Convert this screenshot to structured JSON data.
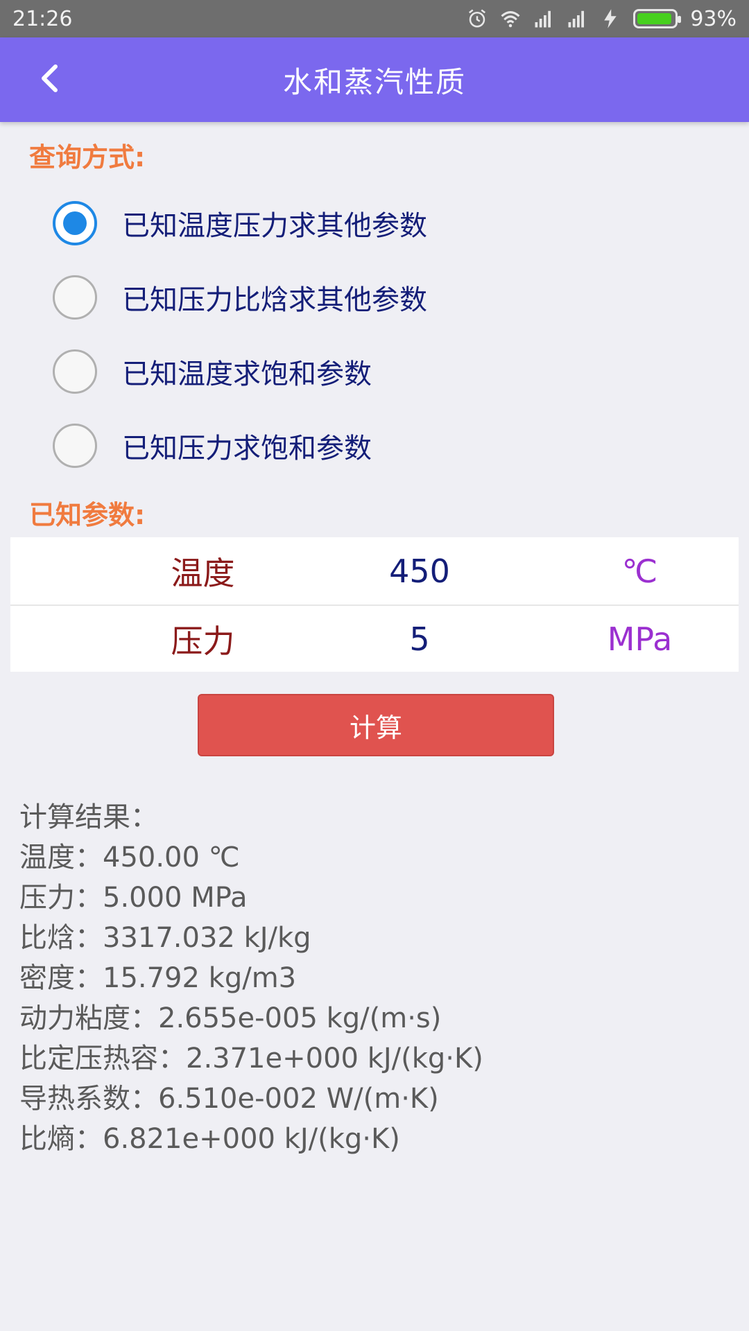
{
  "status": {
    "time": "21:26",
    "battery": "93%",
    "battery_level": 0.93
  },
  "appbar": {
    "title": "水和蒸汽性质",
    "back_icon": "chevron-left-icon"
  },
  "query": {
    "label": "查询方式:",
    "options": [
      {
        "label": "已知温度压力求其他参数",
        "checked": true
      },
      {
        "label": "已知压力比焓求其他参数",
        "checked": false
      },
      {
        "label": "已知温度求饱和参数",
        "checked": false
      },
      {
        "label": "已知压力求饱和参数",
        "checked": false
      }
    ]
  },
  "params": {
    "label": "已知参数:",
    "rows": [
      {
        "name": "温度",
        "value": "450",
        "unit": "℃"
      },
      {
        "name": "压力",
        "value": "5",
        "unit": "MPa"
      }
    ]
  },
  "calc_button": "计算",
  "results": {
    "lines": [
      "计算结果：",
      "温度：450.00 ℃",
      "压力：5.000 MPa",
      "比焓：3317.032 kJ/kg",
      "密度：15.792 kg/m3",
      "动力粘度：2.655e-005 kg/(m·s)",
      "比定压热容：2.371e+000 kJ/(kg·K)",
      "导热系数：6.510e-002 W/(m·K)",
      "比熵：6.821e+000 kJ/(kg·K)"
    ]
  },
  "colors": {
    "appbar": "#7B68EE",
    "section_label": "#F07B3F",
    "radio_checked": "#1E88E5",
    "button": "#E0534F"
  }
}
